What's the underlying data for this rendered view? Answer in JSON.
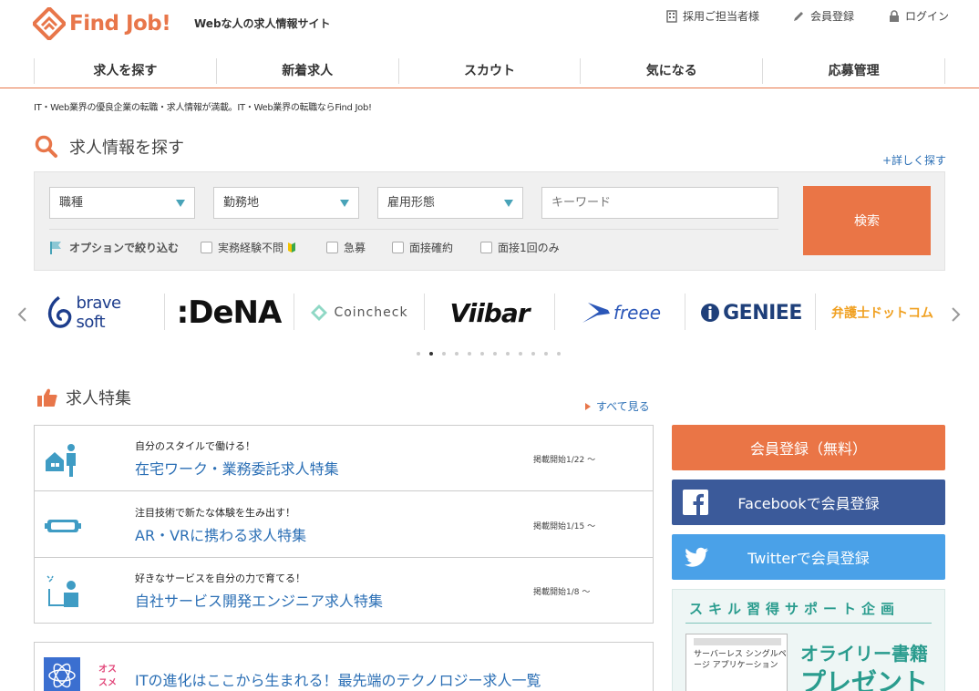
{
  "header": {
    "logo_text": "Find Job!",
    "tagline": "Webな人の求人情報サイト",
    "util_links": [
      "採用ご担当者様",
      "会員登録",
      "ログイン"
    ]
  },
  "nav": [
    "求人を探す",
    "新着求人",
    "スカウト",
    "気になる",
    "応募管理"
  ],
  "lead": "IT・Web業界の優良企業の転職・求人情報が満載。IT・Web業界の転職ならFind Job!",
  "search": {
    "title": "求人情報を探す",
    "detail_link": "+詳しく探す",
    "selects": [
      "職種",
      "勤務地",
      "雇用形態"
    ],
    "keyword_placeholder": "キーワード",
    "button": "検索",
    "option_label": "オプションで絞り込む",
    "options": [
      "実務経験不問",
      "急募",
      "面接確約",
      "面接1回のみ"
    ]
  },
  "brands": [
    "brave soft",
    ":DeNA",
    "Coincheck",
    "Viibar",
    "freee",
    "GENIEE",
    "弁護士ドットコム"
  ],
  "carousel": {
    "dot_count": 12,
    "active_index": 1
  },
  "features": {
    "title": "求人特集",
    "all_link": "すべて見る",
    "items": [
      {
        "sub": "自分のスタイルで働ける！",
        "name": "在宅ワーク・業務委託求人特集",
        "date": "掲載開始1/22 〜",
        "icon": "remote-work-icon"
      },
      {
        "sub": "注目技術で新たな体験を生み出す！",
        "name": "AR・VRに携わる求人特集",
        "date": "掲載開始1/15 〜",
        "icon": "vr-goggles-icon"
      },
      {
        "sub": "好きなサービスを自分の力で育てる！",
        "name": "自社サービス開発エンジニア求人特集",
        "date": "掲載開始1/8 〜",
        "icon": "developer-icon"
      }
    ],
    "osusume_tag": "オススメ",
    "osusume_text": "ITの進化はここから生まれる！最先端のテクノロジー求人一覧"
  },
  "side": {
    "register": "会員登録（無料）",
    "facebook": "Facebookで会員登録",
    "twitter": "Twitterで会員登録",
    "banner_title": "スキル習得サポート企画",
    "book_title": "サーバーレス シングルページ アプリケーション",
    "banner_line1": "オライリー書籍",
    "banner_line2": "プレゼント"
  },
  "colors": {
    "accent": "#e8764a",
    "link": "#2b6fb5",
    "facebook": "#3b5a9a",
    "twitter": "#4aa1e8"
  }
}
